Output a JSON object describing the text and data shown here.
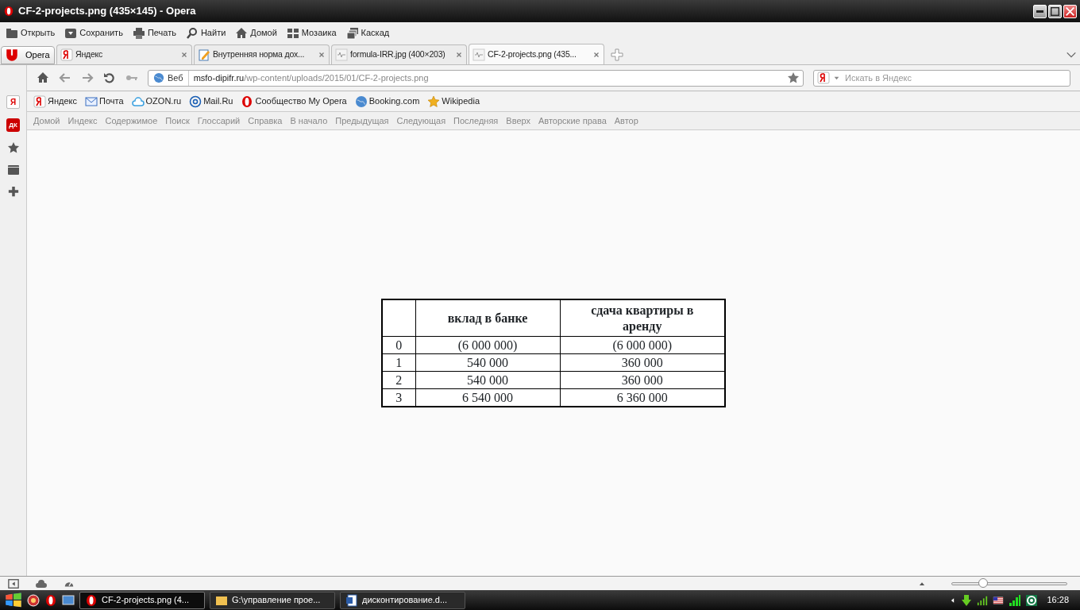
{
  "window": {
    "title": "CF-2-projects.png (435×145) - Opera"
  },
  "toolbar": [
    {
      "kind": "folder",
      "label": "Открыть"
    },
    {
      "kind": "save",
      "label": "Сохранить"
    },
    {
      "kind": "print",
      "label": "Печать"
    },
    {
      "kind": "find",
      "label": "Найти"
    },
    {
      "kind": "home",
      "label": "Домой"
    },
    {
      "kind": "tile",
      "label": "Мозаика"
    },
    {
      "kind": "cascade",
      "label": "Каскад"
    }
  ],
  "opera_menu": {
    "label": "Opera"
  },
  "tabs": [
    {
      "kind": "yandex",
      "label": "Яндекс",
      "selected": false
    },
    {
      "kind": "doc",
      "label": "Внутренняя норма дох...",
      "selected": false
    },
    {
      "kind": "image",
      "label": "formula-IRR.jpg (400×203)",
      "selected": false
    },
    {
      "kind": "image",
      "label": "CF-2-projects.png (435...",
      "selected": true
    }
  ],
  "address_bar": {
    "scope": "Веб",
    "domain": "msfo-dipifr.ru",
    "path": "/wp-content/uploads/2015/01/CF-2-projects.png"
  },
  "search": {
    "placeholder": "Искать в Яндекс"
  },
  "sidebar": [
    {
      "kind": "yandex",
      "label": "Я"
    },
    {
      "kind": "badge",
      "label": "ДК"
    },
    {
      "kind": "star"
    },
    {
      "kind": "panel"
    },
    {
      "kind": "add"
    }
  ],
  "bookmarks": [
    {
      "kind": "yandex",
      "label": "Яндекс"
    },
    {
      "kind": "mail",
      "label": "Почта"
    },
    {
      "kind": "cloud",
      "label": "OZON.ru"
    },
    {
      "kind": "at",
      "label": "Mail.Ru"
    },
    {
      "kind": "opera",
      "label": "Сообщество My Opera"
    },
    {
      "kind": "globe",
      "label": "Booking.com"
    },
    {
      "kind": "star",
      "label": "Wikipedia"
    }
  ],
  "nav_links": [
    "Домой",
    "Индекс",
    "Содержимое",
    "Поиск",
    "Глоссарий",
    "Справка",
    "В начало",
    "Предыдущая",
    "Следующая",
    "Последняя",
    "Вверх",
    "Авторские права",
    "Автор"
  ],
  "table": {
    "columns": [
      "",
      "вклад в банке",
      "сдача квартиры в аренду"
    ],
    "rows": [
      [
        "0",
        "(6 000 000)",
        "(6 000 000)"
      ],
      [
        "1",
        "540 000",
        "360 000"
      ],
      [
        "2",
        "540 000",
        "360 000"
      ],
      [
        "3",
        "6 540 000",
        "6 360 000"
      ]
    ]
  },
  "status_bar": {
    "zoom": {
      "level": 0.27
    }
  },
  "taskbar": {
    "items": [
      {
        "kind": "opera",
        "label": "CF-2-projects.png (4...",
        "selected": true
      },
      {
        "kind": "folder",
        "label": "G:\\управление прое...",
        "selected": false
      },
      {
        "kind": "word",
        "label": "дисконтирование.d...",
        "selected": false
      }
    ],
    "clock": "16:28"
  }
}
